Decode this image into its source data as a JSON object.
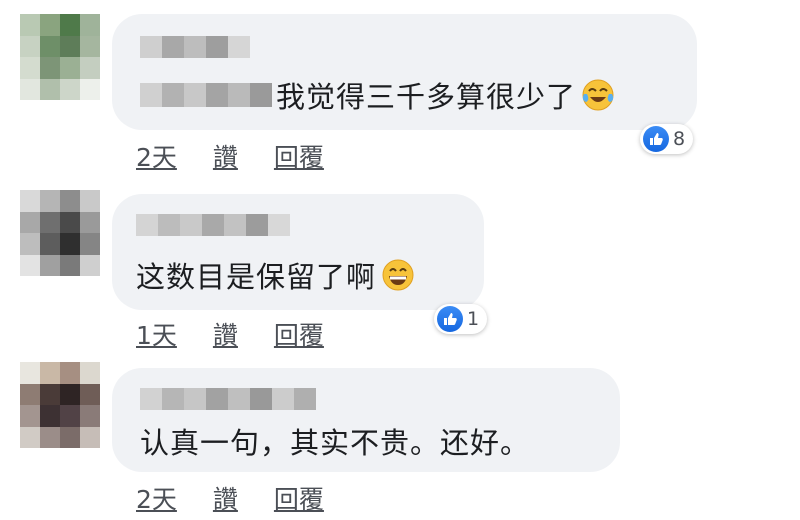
{
  "comments": [
    {
      "text": "我觉得三千多算很少了",
      "emoji": "tears-of-joy-emoji",
      "reaction_count": "8",
      "time": "2天",
      "like_label": "讚",
      "reply_label": "回覆",
      "avatar_colors": [
        "#b9c9b3",
        "#8aa47f",
        "#4f7a4a",
        "#9fb39a",
        "#c7d2c2",
        "#6e8f68",
        "#5e7d59",
        "#a5b69f",
        "#d4dccf",
        "#7d9577",
        "#9bb094",
        "#c4cec0",
        "#e2e7df",
        "#b0bfab",
        "#cdd6c9",
        "#edf0eb"
      ]
    },
    {
      "text": "这数目是保留了啊",
      "emoji": "grinning-emoji",
      "reaction_count": "1",
      "time": "1天",
      "like_label": "讚",
      "reply_label": "回覆",
      "avatar_colors": [
        "#d9d9d9",
        "#b5b5b5",
        "#8d8d8d",
        "#c9c9c9",
        "#a8a8a8",
        "#6f6f6f",
        "#4a4a4a",
        "#9a9a9a",
        "#bdbdbd",
        "#5d5d5d",
        "#2f2f2f",
        "#858585",
        "#e3e3e3",
        "#a0a0a0",
        "#7a7a7a",
        "#cfcfcf"
      ]
    },
    {
      "text": "认真一句，其实不贵。还好。",
      "time": "2天",
      "like_label": "讚",
      "reply_label": "回覆",
      "avatar_colors": [
        "#e8e6df",
        "#c9b8a6",
        "#a68f82",
        "#dcd8cf",
        "#8e7c73",
        "#4a3b38",
        "#2e2424",
        "#6f5d57",
        "#a39590",
        "#3d3133",
        "#514246",
        "#8a7b78",
        "#d1cbc5",
        "#9b8d89",
        "#7b6c69",
        "#c6bdb7"
      ]
    }
  ],
  "colors": {
    "bubble": "#f0f2f5",
    "like_blue": "#1877f2",
    "meta_text": "#4b4f56"
  }
}
